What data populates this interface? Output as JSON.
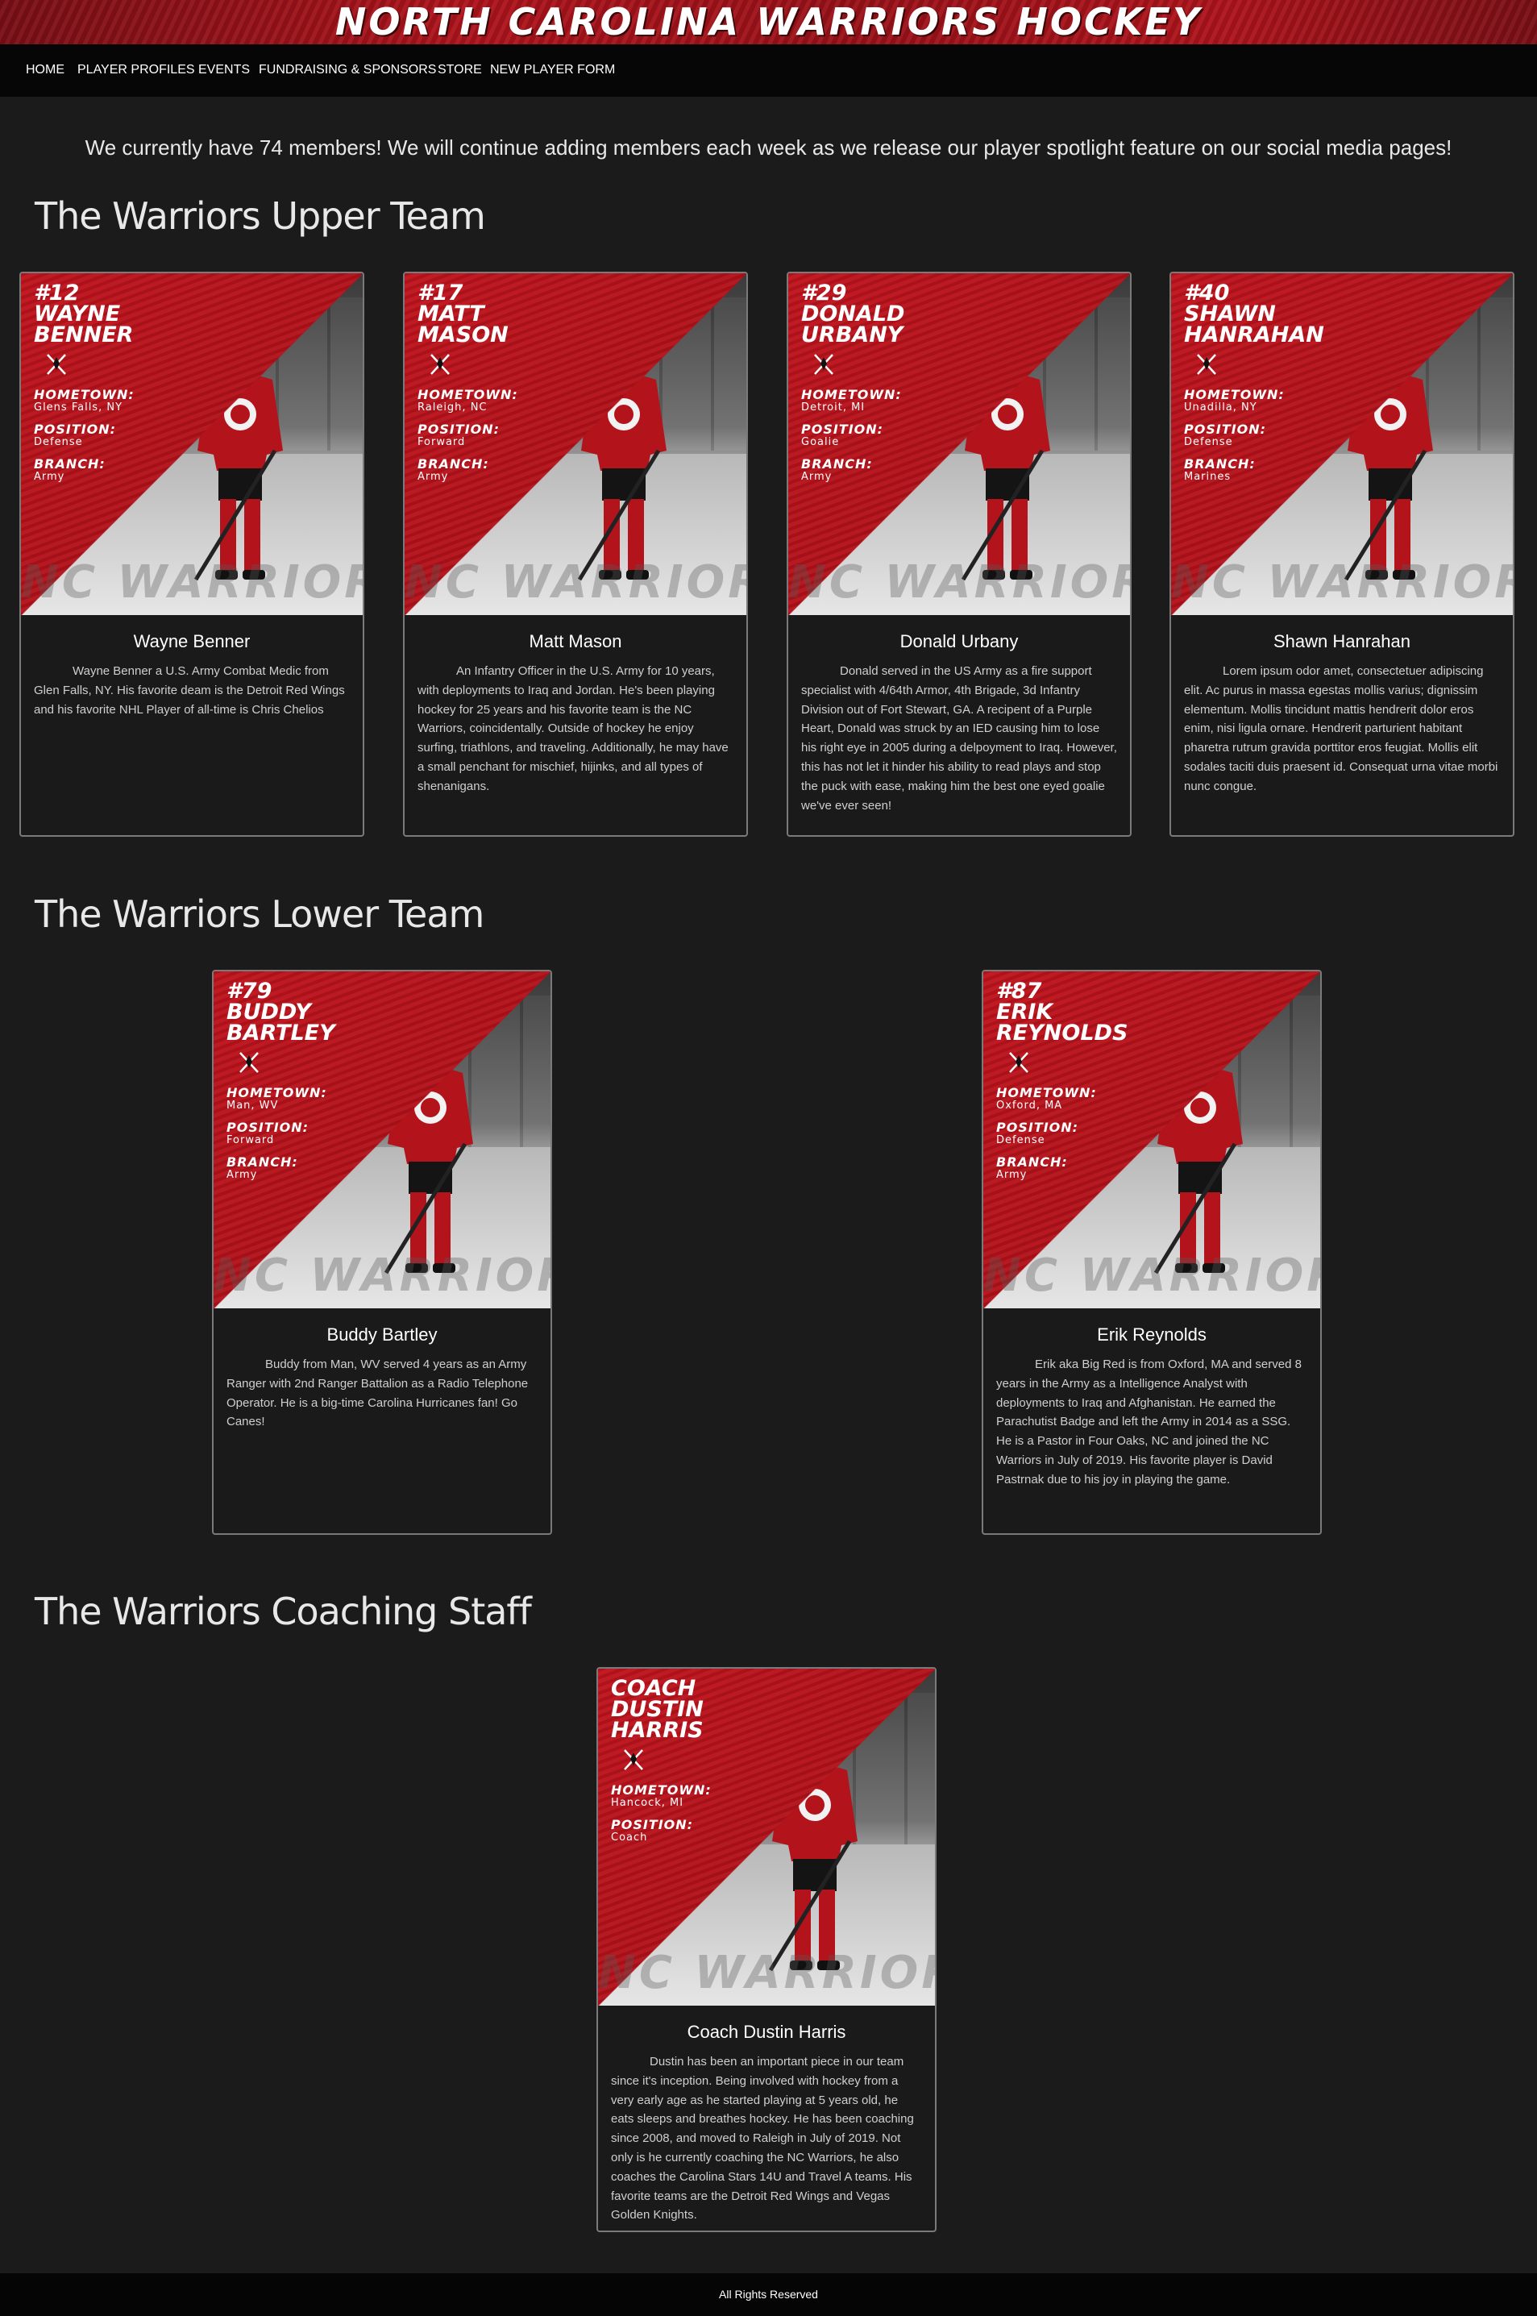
{
  "site": {
    "banner_title": "NORTH CAROLINA WARRIORS HOCKEY"
  },
  "nav": {
    "items": [
      {
        "label": "HOME"
      },
      {
        "label": "PLAYER PROFILES"
      },
      {
        "label": "EVENTS"
      },
      {
        "label": "FUNDRAISING & SPONSORS"
      },
      {
        "label": "STORE"
      },
      {
        "label": "NEW PLAYER FORM"
      }
    ]
  },
  "intro": "We currently have 74 members! We will continue adding members each week as we release our player spotlight feature on our social media pages!",
  "sections": {
    "upper": {
      "title": "The Warriors Upper Team",
      "cards": [
        {
          "number": "#12",
          "first": "WAYNE",
          "last": "BENNER",
          "hometown_label": "HOMETOWN:",
          "hometown": "Glens Falls, NY",
          "position_label": "POSITION:",
          "position": "Defense",
          "branch_label": "BRANCH:",
          "branch": "Army",
          "watermark": "NC WARRIORS",
          "name": "Wayne Benner",
          "bio": "Wayne Benner a U.S. Army Combat Medic from Glen Falls, NY. His favorite deam is the Detroit Red Wings and his favorite NHL Player of all-time is Chris Chelios"
        },
        {
          "number": "#17",
          "first": "MATT",
          "last": "MASON",
          "hometown_label": "HOMETOWN:",
          "hometown": "Raleigh, NC",
          "position_label": "POSITION:",
          "position": "Forward",
          "branch_label": "BRANCH:",
          "branch": "Army",
          "watermark": "NC WARRIORS",
          "name": "Matt Mason",
          "bio": "An Infantry Officer in the U.S. Army for 10 years, with deployments to Iraq and Jordan. He's been playing hockey for 25 years and his favorite team is the NC Warriors, coincidentally. Outside of hockey he enjoy surfing, triathlons, and traveling. Additionally, he may have a small penchant for mischief, hijinks, and all types of shenanigans."
        },
        {
          "number": "#29",
          "first": "DONALD",
          "last": "URBANY",
          "hometown_label": "HOMETOWN:",
          "hometown": "Detroit, MI",
          "position_label": "POSITION:",
          "position": "Goalie",
          "branch_label": "BRANCH:",
          "branch": "Army",
          "watermark": "NC WARRIORS",
          "name": "Donald Urbany",
          "bio": "Donald served in the US Army as a fire support specialist with 4/64th Armor, 4th Brigade, 3d Infantry Division out of Fort Stewart, GA. A recipent of a Purple Heart, Donald was struck by an IED causing him to lose his right eye in 2005 during a delpoyment to Iraq. However, this has not let it hinder his ability to read plays and stop the puck with ease, making him the best one eyed goalie we've ever seen!"
        },
        {
          "number": "#40",
          "first": "SHAWN",
          "last": "HANRAHAN",
          "hometown_label": "HOMETOWN:",
          "hometown": "Unadilla, NY",
          "position_label": "POSITION:",
          "position": "Defense",
          "branch_label": "BRANCH:",
          "branch": "Marines",
          "watermark": "NC WARRIORS",
          "name": "Shawn Hanrahan",
          "bio": "Lorem ipsum odor amet, consectetuer adipiscing elit. Ac purus in massa egestas mollis varius; dignissim elementum. Mollis tincidunt mattis hendrerit dolor eros enim, nisi ligula ornare. Hendrerit parturient habitant pharetra rutrum gravida porttitor eros feugiat. Mollis elit sodales taciti duis praesent id. Consequat urna vitae morbi nunc congue."
        }
      ]
    },
    "lower": {
      "title": "The Warriors Lower Team",
      "cards": [
        {
          "number": "#79",
          "first": "BUDDY",
          "last": "BARTLEY",
          "hometown_label": "HOMETOWN:",
          "hometown": "Man, WV",
          "position_label": "POSITION:",
          "position": "Forward",
          "branch_label": "BRANCH:",
          "branch": "Army",
          "watermark": "NC WARRIORS",
          "name": "Buddy Bartley",
          "bio": "Buddy from Man, WV served 4 years as an Army Ranger with 2nd Ranger Battalion as a Radio Telephone Operator. He is a big-time Carolina Hurricanes fan! Go Canes!"
        },
        {
          "number": "#87",
          "first": "ERIK",
          "last": "REYNOLDS",
          "hometown_label": "HOMETOWN:",
          "hometown": "Oxford, MA",
          "position_label": "POSITION:",
          "position": "Defense",
          "branch_label": "BRANCH:",
          "branch": "Army",
          "watermark": "NC WARRIORS",
          "name": "Erik Reynolds",
          "bio": "Erik aka Big Red is from Oxford, MA and served 8 years in the Army as a Intelligence Analyst with deployments to Iraq and Afghanistan. He earned the Parachutist Badge and left the Army in 2014 as a SSG. He is a Pastor in Four Oaks, NC and joined the NC Warriors in July of 2019. His favorite player is David Pastrnak due to his joy in playing the game."
        }
      ]
    },
    "coaching": {
      "title": "The Warriors Coaching Staff",
      "cards": [
        {
          "number": "COACH",
          "first": "DUSTIN",
          "last": "HARRIS",
          "hometown_label": "HOMETOWN:",
          "hometown": "Hancock, MI",
          "position_label": "POSITION:",
          "position": "Coach",
          "watermark": "NC WARRIORS",
          "name": "Coach Dustin Harris",
          "bio": "Dustin has been an important piece in our team since it's inception. Being involved with hockey from a very early age as he started playing at 5 years old, he eats sleeps and breathes hockey. He has been coaching since 2008, and moved to Raleigh in July of 2019. Not only is he currently coaching the NC Warriors, he also coaches the Carolina Stars 14U and Travel A teams. His favorite teams are the Detroit Red Wings and Vegas Golden Knights."
        }
      ]
    }
  },
  "footer": "All Rights Reserved",
  "colors": {
    "background": "#1b1b1b",
    "brand_red": "#c0141d",
    "nav_bg": "#060606"
  }
}
